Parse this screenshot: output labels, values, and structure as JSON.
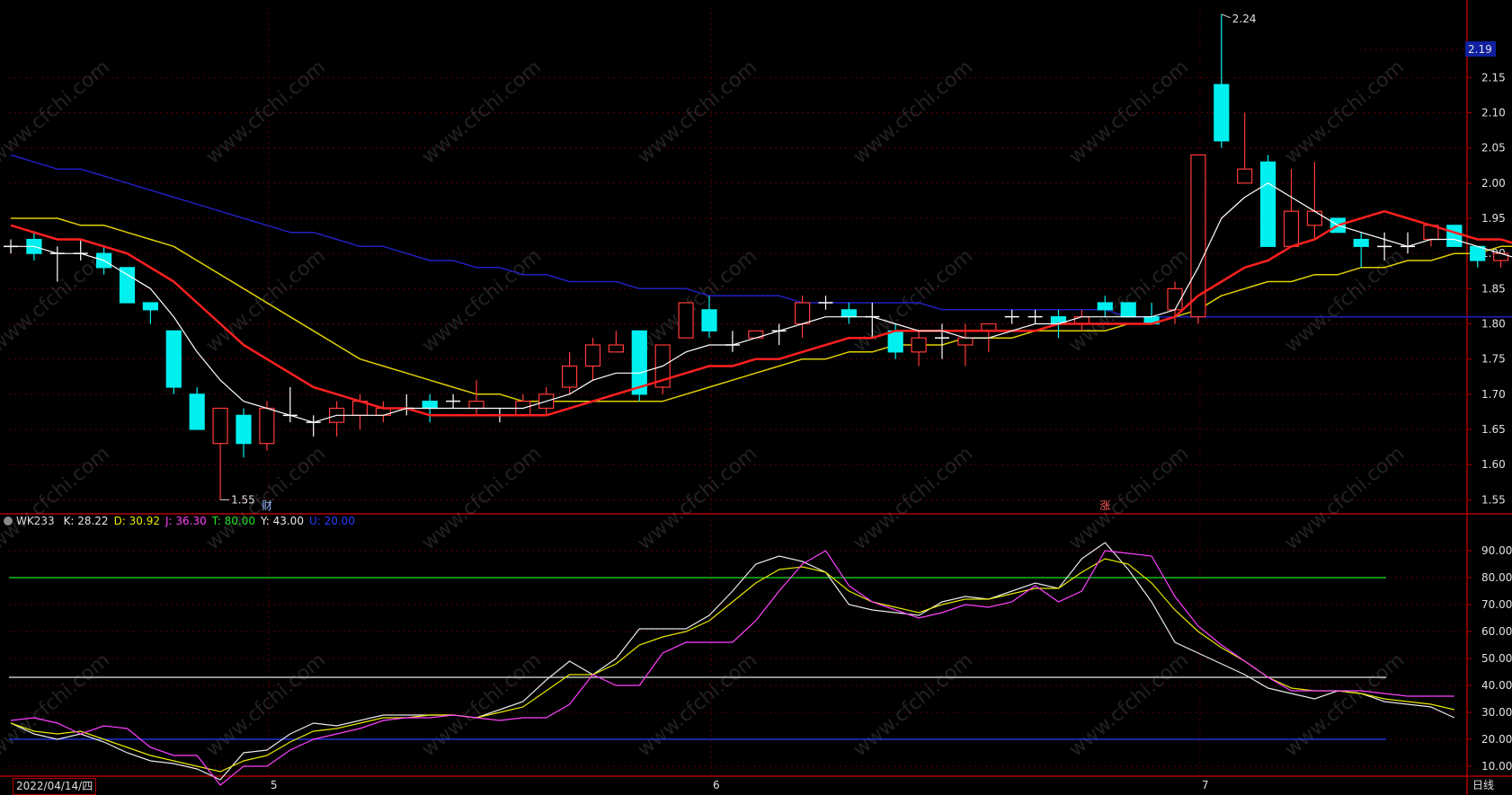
{
  "window": {
    "period_label": "日线",
    "current_date_label": "2022/04/14/四"
  },
  "main_chart": {
    "price_tag": "2.19",
    "high_annotation": "2.24",
    "low_annotation": "1.55",
    "markers": [
      {
        "label": "财",
        "color": "#8fb8ff",
        "index": 11
      },
      {
        "label": "涨",
        "color": "#ff5a5a",
        "index": 47
      }
    ],
    "watermark": "www.cfchi.com"
  },
  "indicator_legend": {
    "name": "WK233",
    "items": [
      {
        "text": "K: 28.22",
        "color": "#e8e8e8"
      },
      {
        "text": "D: 30.92",
        "color": "#e8e800"
      },
      {
        "text": "J: 36.30",
        "color": "#ff40ff"
      },
      {
        "text": "T: 80.00",
        "color": "#20e020"
      },
      {
        "text": "Y: 43.00",
        "color": "#e8e8e8"
      },
      {
        "text": "U: 20.00",
        "color": "#2a3cff"
      }
    ]
  },
  "colors": {
    "up": "#ff3a3a",
    "down": "#00f0f0",
    "ma_fast": "#ffffff",
    "ma_mid": "#ff2020",
    "ma_slow": "#e0d000",
    "ma_long": "#2020c0",
    "grid": "#5a0000",
    "axis": "#b00000"
  },
  "chart_data": [
    {
      "type": "candlestick",
      "title": "",
      "y_ticks": [
        1.55,
        1.6,
        1.65,
        1.7,
        1.75,
        1.8,
        1.85,
        1.9,
        1.95,
        2.0,
        2.05,
        2.1,
        2.15
      ],
      "ylim": [
        1.53,
        2.25
      ],
      "x_month_labels": [
        {
          "label": "5",
          "index": 11
        },
        {
          "label": "6",
          "index": 30
        },
        {
          "label": "7",
          "index": 51
        }
      ],
      "grid": true,
      "candles": [
        [
          1.91,
          1.92,
          1.9,
          1.91
        ],
        [
          1.92,
          1.93,
          1.89,
          1.9
        ],
        [
          1.9,
          1.91,
          1.86,
          1.9
        ],
        [
          1.9,
          1.92,
          1.89,
          1.9
        ],
        [
          1.9,
          1.91,
          1.87,
          1.88
        ],
        [
          1.88,
          1.88,
          1.83,
          1.83
        ],
        [
          1.83,
          1.83,
          1.8,
          1.82
        ],
        [
          1.79,
          1.79,
          1.7,
          1.71
        ],
        [
          1.7,
          1.71,
          1.65,
          1.65
        ],
        [
          1.63,
          1.68,
          1.55,
          1.68
        ],
        [
          1.67,
          1.68,
          1.61,
          1.63
        ],
        [
          1.63,
          1.69,
          1.62,
          1.68
        ],
        [
          1.67,
          1.71,
          1.66,
          1.67
        ],
        [
          1.66,
          1.67,
          1.64,
          1.66
        ],
        [
          1.66,
          1.69,
          1.64,
          1.68
        ],
        [
          1.67,
          1.7,
          1.65,
          1.69
        ],
        [
          1.67,
          1.69,
          1.66,
          1.68
        ],
        [
          1.68,
          1.7,
          1.67,
          1.68
        ],
        [
          1.69,
          1.7,
          1.66,
          1.68
        ],
        [
          1.69,
          1.7,
          1.68,
          1.69
        ],
        [
          1.68,
          1.72,
          1.67,
          1.69
        ],
        [
          1.67,
          1.68,
          1.66,
          1.67
        ],
        [
          1.67,
          1.7,
          1.67,
          1.69
        ],
        [
          1.68,
          1.71,
          1.67,
          1.7
        ],
        [
          1.71,
          1.76,
          1.7,
          1.74
        ],
        [
          1.74,
          1.78,
          1.72,
          1.77
        ],
        [
          1.76,
          1.79,
          1.76,
          1.77
        ],
        [
          1.79,
          1.79,
          1.69,
          1.7
        ],
        [
          1.71,
          1.77,
          1.7,
          1.77
        ],
        [
          1.78,
          1.83,
          1.78,
          1.83
        ],
        [
          1.82,
          1.84,
          1.78,
          1.79
        ],
        [
          1.77,
          1.79,
          1.76,
          1.77
        ],
        [
          1.78,
          1.79,
          1.78,
          1.79
        ],
        [
          1.79,
          1.8,
          1.77,
          1.79
        ],
        [
          1.8,
          1.84,
          1.78,
          1.83
        ],
        [
          1.83,
          1.84,
          1.82,
          1.83
        ],
        [
          1.82,
          1.83,
          1.8,
          1.81
        ],
        [
          1.81,
          1.83,
          1.78,
          1.81
        ],
        [
          1.79,
          1.8,
          1.75,
          1.76
        ],
        [
          1.76,
          1.79,
          1.74,
          1.78
        ],
        [
          1.78,
          1.8,
          1.75,
          1.78
        ],
        [
          1.77,
          1.8,
          1.74,
          1.78
        ],
        [
          1.79,
          1.8,
          1.76,
          1.8
        ],
        [
          1.81,
          1.82,
          1.8,
          1.81
        ],
        [
          1.81,
          1.82,
          1.8,
          1.81
        ],
        [
          1.81,
          1.82,
          1.78,
          1.8
        ],
        [
          1.8,
          1.82,
          1.79,
          1.81
        ],
        [
          1.83,
          1.84,
          1.81,
          1.82
        ],
        [
          1.83,
          1.83,
          1.81,
          1.81
        ],
        [
          1.81,
          1.83,
          1.8,
          1.8
        ],
        [
          1.82,
          1.86,
          1.8,
          1.85
        ],
        [
          1.81,
          2.04,
          1.8,
          2.04
        ],
        [
          2.14,
          2.24,
          2.05,
          2.06
        ],
        [
          2.0,
          2.1,
          2.0,
          2.02
        ],
        [
          2.03,
          2.04,
          1.91,
          1.91
        ],
        [
          1.91,
          2.02,
          1.91,
          1.96
        ],
        [
          1.94,
          2.03,
          1.92,
          1.96
        ],
        [
          1.95,
          1.95,
          1.93,
          1.93
        ],
        [
          1.92,
          1.93,
          1.88,
          1.91
        ],
        [
          1.91,
          1.93,
          1.89,
          1.91
        ],
        [
          1.91,
          1.93,
          1.9,
          1.91
        ],
        [
          1.92,
          1.94,
          1.91,
          1.94
        ],
        [
          1.94,
          1.94,
          1.91,
          1.91
        ],
        [
          1.91,
          1.91,
          1.88,
          1.89
        ],
        [
          1.89,
          1.9,
          1.88,
          1.9
        ],
        [
          1.89,
          1.89,
          1.85,
          1.86
        ]
      ],
      "ma_fast": [
        1.91,
        1.91,
        1.9,
        1.9,
        1.89,
        1.87,
        1.85,
        1.81,
        1.76,
        1.72,
        1.69,
        1.68,
        1.67,
        1.66,
        1.67,
        1.67,
        1.67,
        1.68,
        1.68,
        1.68,
        1.68,
        1.68,
        1.68,
        1.69,
        1.7,
        1.72,
        1.73,
        1.73,
        1.74,
        1.76,
        1.77,
        1.77,
        1.78,
        1.79,
        1.8,
        1.81,
        1.81,
        1.81,
        1.8,
        1.79,
        1.79,
        1.78,
        1.78,
        1.79,
        1.8,
        1.8,
        1.81,
        1.81,
        1.81,
        1.81,
        1.82,
        1.88,
        1.95,
        1.98,
        2.0,
        1.98,
        1.96,
        1.94,
        1.93,
        1.92,
        1.91,
        1.92,
        1.92,
        1.91,
        1.9,
        1.89
      ],
      "ma_mid": [
        1.94,
        1.93,
        1.92,
        1.92,
        1.91,
        1.9,
        1.88,
        1.86,
        1.83,
        1.8,
        1.77,
        1.75,
        1.73,
        1.71,
        1.7,
        1.69,
        1.68,
        1.68,
        1.67,
        1.67,
        1.67,
        1.67,
        1.67,
        1.67,
        1.68,
        1.69,
        1.7,
        1.71,
        1.72,
        1.73,
        1.74,
        1.74,
        1.75,
        1.75,
        1.76,
        1.77,
        1.78,
        1.78,
        1.79,
        1.79,
        1.79,
        1.79,
        1.79,
        1.79,
        1.79,
        1.8,
        1.8,
        1.8,
        1.8,
        1.8,
        1.81,
        1.84,
        1.86,
        1.88,
        1.89,
        1.91,
        1.92,
        1.94,
        1.95,
        1.96,
        1.95,
        1.94,
        1.93,
        1.92,
        1.92,
        1.91
      ],
      "ma_slow": [
        1.95,
        1.95,
        1.95,
        1.94,
        1.94,
        1.93,
        1.92,
        1.91,
        1.89,
        1.87,
        1.85,
        1.83,
        1.81,
        1.79,
        1.77,
        1.75,
        1.74,
        1.73,
        1.72,
        1.71,
        1.7,
        1.7,
        1.69,
        1.69,
        1.69,
        1.69,
        1.69,
        1.69,
        1.69,
        1.7,
        1.71,
        1.72,
        1.73,
        1.74,
        1.75,
        1.75,
        1.76,
        1.76,
        1.77,
        1.77,
        1.77,
        1.78,
        1.78,
        1.78,
        1.79,
        1.79,
        1.79,
        1.79,
        1.8,
        1.8,
        1.81,
        1.82,
        1.84,
        1.85,
        1.86,
        1.86,
        1.87,
        1.87,
        1.88,
        1.88,
        1.89,
        1.89,
        1.9,
        1.9,
        1.91,
        1.91
      ],
      "ma_long": [
        2.04,
        2.03,
        2.02,
        2.02,
        2.01,
        2.0,
        1.99,
        1.98,
        1.97,
        1.96,
        1.95,
        1.94,
        1.93,
        1.93,
        1.92,
        1.91,
        1.91,
        1.9,
        1.89,
        1.89,
        1.88,
        1.88,
        1.87,
        1.87,
        1.86,
        1.86,
        1.86,
        1.85,
        1.85,
        1.85,
        1.84,
        1.84,
        1.84,
        1.84,
        1.83,
        1.83,
        1.83,
        1.83,
        1.83,
        1.83,
        1.82,
        1.82,
        1.82,
        1.82,
        1.82,
        1.82,
        1.82,
        1.82,
        1.81,
        1.81,
        1.81,
        1.81,
        1.81,
        1.81,
        1.81,
        1.81,
        1.81,
        1.81,
        1.81,
        1.81,
        1.81,
        1.81,
        1.81,
        1.81,
        1.81,
        1.81
      ]
    },
    {
      "type": "line",
      "title": "",
      "y_ticks": [
        10,
        20,
        30,
        40,
        50,
        60,
        70,
        80,
        90
      ],
      "ylim": [
        7,
        97
      ],
      "reference_lines": [
        {
          "name": "T",
          "value": 80,
          "color": "#20e020"
        },
        {
          "name": "Y",
          "value": 43,
          "color": "#e8e8e8"
        },
        {
          "name": "U",
          "value": 20,
          "color": "#2a3cff"
        }
      ],
      "series": [
        {
          "name": "K",
          "color": "#e8e8e8",
          "values": [
            26,
            22,
            20,
            22,
            19,
            15,
            12,
            11,
            9,
            5,
            15,
            16,
            22,
            26,
            25,
            27,
            29,
            29,
            29,
            29,
            28,
            31,
            34,
            42,
            49,
            44,
            50,
            61,
            61,
            61,
            66,
            75,
            85,
            88,
            86,
            82,
            70,
            68,
            67,
            66,
            71,
            73,
            72,
            75,
            78,
            76,
            87,
            93,
            83,
            71,
            56,
            52,
            48,
            44,
            39,
            37,
            35,
            38,
            37,
            34,
            33,
            32,
            28
          ]
        },
        {
          "name": "D",
          "color": "#e8e800",
          "values": [
            26,
            23,
            22,
            23,
            20,
            17,
            14,
            12,
            10,
            8,
            12,
            14,
            19,
            23,
            24,
            26,
            28,
            28,
            29,
            29,
            28,
            30,
            32,
            38,
            44,
            44,
            48,
            55,
            58,
            60,
            64,
            71,
            78,
            83,
            84,
            82,
            75,
            71,
            69,
            67,
            70,
            72,
            72,
            74,
            76,
            76,
            82,
            87,
            85,
            78,
            68,
            60,
            54,
            49,
            43,
            39,
            38,
            38,
            37,
            35,
            34,
            33,
            31
          ]
        },
        {
          "name": "J",
          "color": "#ff40ff",
          "values": [
            27,
            28,
            26,
            22,
            25,
            24,
            17,
            14,
            14,
            3,
            10,
            10,
            16,
            20,
            22,
            24,
            27,
            28,
            28,
            29,
            28,
            27,
            28,
            28,
            33,
            44,
            40,
            40,
            52,
            56,
            56,
            56,
            64,
            75,
            85,
            90,
            77,
            71,
            68,
            65,
            67,
            70,
            69,
            71,
            77,
            71,
            75,
            90,
            89,
            88,
            73,
            62,
            55,
            49,
            43,
            38,
            38,
            38,
            38,
            37,
            36,
            36,
            36
          ]
        }
      ]
    }
  ]
}
